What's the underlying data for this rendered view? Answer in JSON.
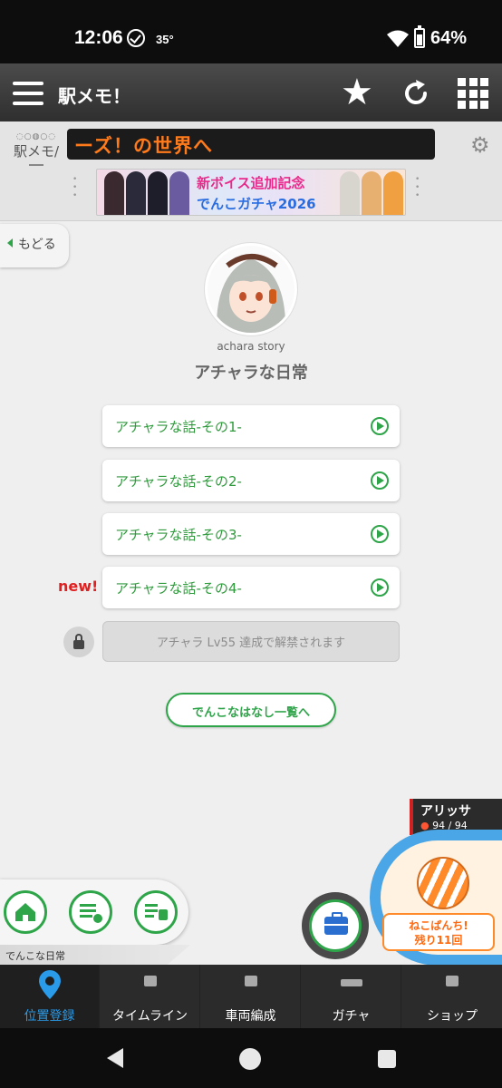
{
  "status_bar": {
    "time": "12:06",
    "temperature": "35°",
    "battery": "64%"
  },
  "app_header": {
    "title": "駅メモ！"
  },
  "banner": {
    "logo_text": "駅メモ/",
    "ticker": "ーズ！の世界へ",
    "ad_line1": "新ボイス追加記念",
    "ad_line2": "でんこガチャ2026"
  },
  "back_button": {
    "label": "もどる"
  },
  "story": {
    "subtitle": "achara story",
    "title": "アチャラな日常",
    "episodes": [
      {
        "label": "アチャラな話-その1-"
      },
      {
        "label": "アチャラな話-その2-"
      },
      {
        "label": "アチャラな話-その3-"
      },
      {
        "label": "アチャラな話-その4-"
      }
    ],
    "new_badge": "new!",
    "locked_message": "アチャラ Lv55 達成で解禁されます",
    "list_link": "でんこなはなし一覧へ"
  },
  "character": {
    "name": "アリッサ",
    "hp": "94 / 94"
  },
  "nekopanchi": {
    "line1": "ねこぱんち!",
    "line2": "残り11回"
  },
  "dock": {
    "caption": "でんこな日常"
  },
  "tabs": [
    {
      "label": "位置登録",
      "icon": "location-pin-icon"
    },
    {
      "label": "タイムライン",
      "icon": "house-icon"
    },
    {
      "label": "車両編成",
      "icon": "train-formation-icon"
    },
    {
      "label": "ガチャ",
      "icon": "ticket-icon"
    },
    {
      "label": "ショップ",
      "icon": "cart-icon"
    }
  ],
  "colors": {
    "accent_green": "#2fa54a",
    "active_tab_blue": "#2a9be8",
    "new_red": "#e02020"
  }
}
